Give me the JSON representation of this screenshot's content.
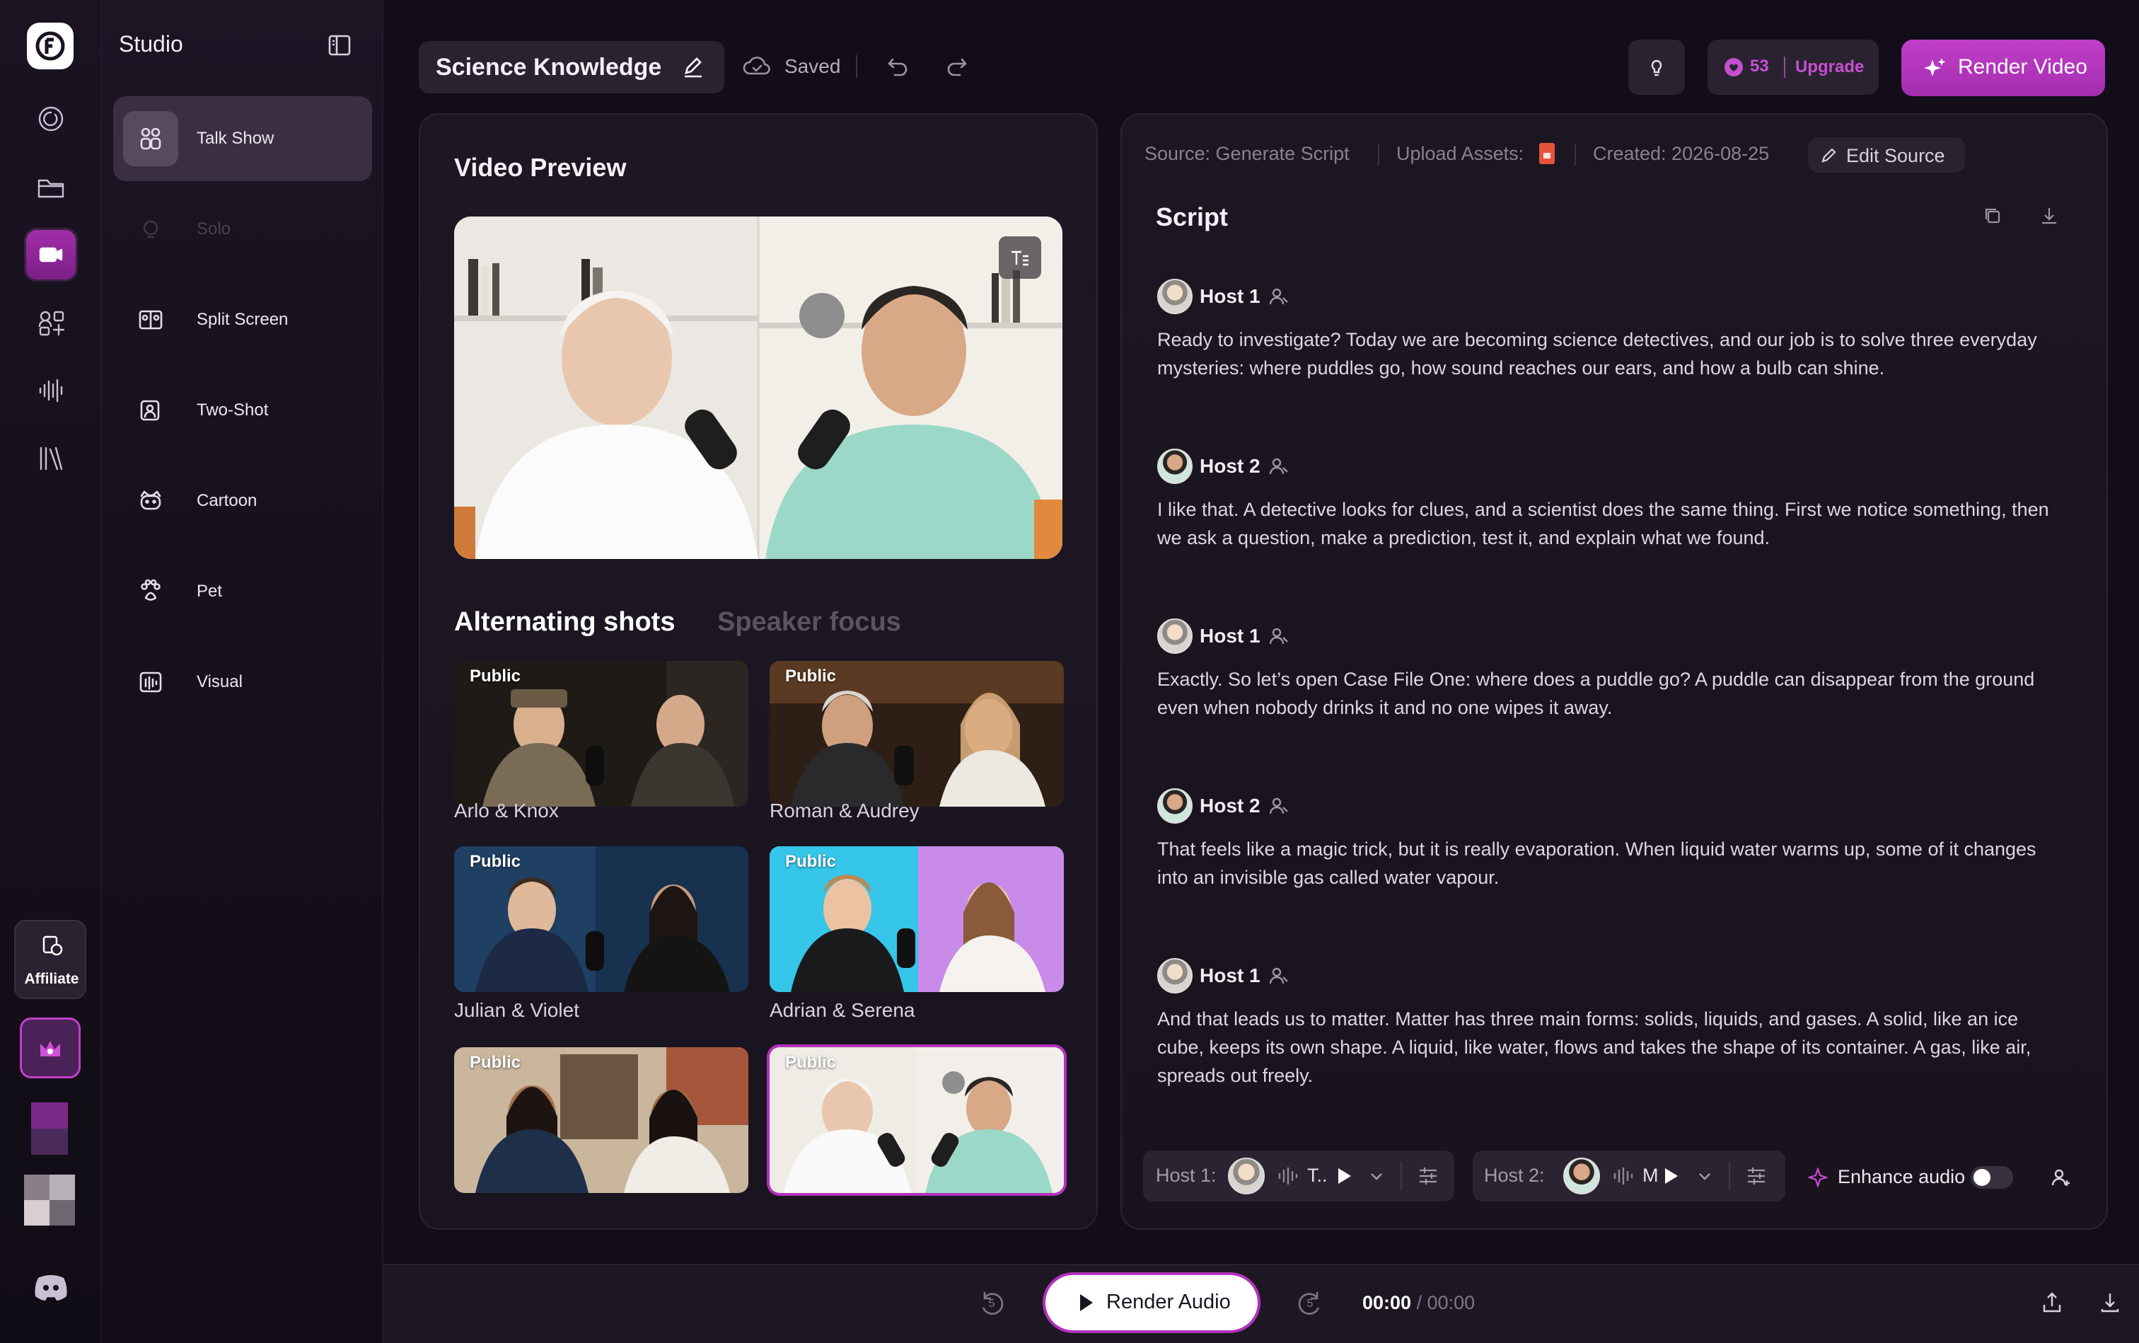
{
  "colors": {
    "accent": "#b132bb",
    "bg": "#120d18",
    "panel": "#1c1622"
  },
  "sidebar": {
    "title": "Studio",
    "items": [
      {
        "label": "Talk Show",
        "icon": "talk-show-icon",
        "state": "active"
      },
      {
        "label": "Solo",
        "icon": "solo-icon",
        "state": "disabled"
      },
      {
        "label": "Split Screen",
        "icon": "split-screen-icon",
        "state": "normal"
      },
      {
        "label": "Two-Shot",
        "icon": "two-shot-icon",
        "state": "normal"
      },
      {
        "label": "Cartoon",
        "icon": "cartoon-icon",
        "state": "normal"
      },
      {
        "label": "Pet",
        "icon": "pet-icon",
        "state": "normal"
      },
      {
        "label": "Visual",
        "icon": "visual-icon",
        "state": "normal"
      }
    ]
  },
  "rail": {
    "affiliate_label": "Affiliate"
  },
  "header": {
    "project_title": "Science Knowledge",
    "save_status": "Saved",
    "credits": "53",
    "upgrade_label": "Upgrade",
    "render_video_label": "Render Video"
  },
  "video": {
    "title": "Video Preview",
    "tabs": [
      {
        "label": "Alternating shots",
        "active": true
      },
      {
        "label": "Speaker focus",
        "active": false
      }
    ],
    "public_badge": "Public",
    "hosts": [
      {
        "name": "Arlo & Knox"
      },
      {
        "name": "Roman & Audrey"
      },
      {
        "name": "Julian & Violet"
      },
      {
        "name": "Adrian & Serena"
      },
      {
        "name": ""
      },
      {
        "name": "",
        "selected": true
      }
    ]
  },
  "script": {
    "source_label": "Source: Generate Script",
    "upload_label": "Upload Assets:",
    "created_label": "Created: 2026-08-25",
    "edit_source_label": "Edit Source",
    "title": "Script",
    "lines": [
      {
        "host": "Host 1",
        "text": "Ready to investigate? Today we are becoming science detectives, and our job is to solve three everyday mysteries: where puddles go, how sound reaches our ears, and how a bulb can shine."
      },
      {
        "host": "Host 2",
        "text": "I like that. A detective looks for clues, and a scientist does the same thing. First we notice something, then we ask a question, make a prediction, test it, and explain what we found."
      },
      {
        "host": "Host 1",
        "text": "Exactly. So let’s open Case File One: where does a puddle go? A puddle can disappear from the ground even when nobody drinks it and no one wipes it away."
      },
      {
        "host": "Host 2",
        "text": "That feels like a magic trick, but it is really evaporation. When liquid water warms up, some of it changes into an invisible gas called water vapour."
      },
      {
        "host": "Host 1",
        "text": "And that leads us to matter. Matter has three main forms: solids, liquids, and gases. A solid, like an ice cube, keeps its own shape. A liquid, like water, flows and takes the shape of its container. A gas, like air, spreads out freely."
      }
    ],
    "voice1_label": "Host 1:",
    "voice1_value": "T..",
    "voice2_label": "Host 2:",
    "voice2_value": "M",
    "enhance_label": "Enhance audio"
  },
  "transport": {
    "render_audio_label": "Render Audio",
    "current_time": "00:00",
    "separator": "/",
    "total_time": "00:00",
    "skip_back": "5",
    "skip_forward": "5"
  }
}
